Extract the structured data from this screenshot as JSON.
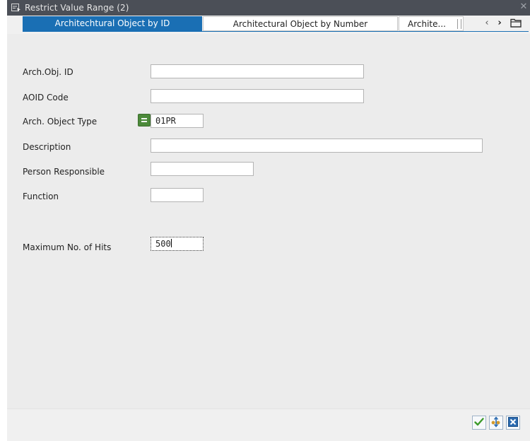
{
  "window": {
    "title": "Restrict Value Range (2)",
    "close_glyph": "✕"
  },
  "tabs": {
    "items": [
      {
        "label": "Architechtural Object by ID",
        "active": true
      },
      {
        "label": "Architectural Object by Number",
        "active": false
      },
      {
        "label": "Archite...",
        "active": false
      }
    ],
    "nav": {
      "prev_glyph": "‹",
      "next_glyph": "›"
    }
  },
  "form": {
    "arch_obj_id": {
      "label": "Arch.Obj. ID",
      "value": ""
    },
    "aoid_code": {
      "label": "AOID Code",
      "value": ""
    },
    "arch_object_type": {
      "label": "Arch. Object Type",
      "value": "01PR"
    },
    "description": {
      "label": "Description",
      "value": ""
    },
    "person_responsible": {
      "label": "Person Responsible",
      "value": ""
    },
    "function": {
      "label": "Function",
      "value": ""
    },
    "max_hits": {
      "label": "Maximum No. of Hits",
      "value": "500"
    }
  },
  "colors": {
    "accent": "#1a6fb4",
    "titlebar": "#4b4f57",
    "ok_green": "#3c9a2a",
    "cancel_blue": "#2a6ab0"
  },
  "icons": {
    "window": "window-icon",
    "equals": "equals-icon",
    "tab_list": "tab-list-icon",
    "confirm": "check-icon",
    "multiple_selection": "multiple-selection-icon",
    "cancel": "cancel-icon"
  }
}
